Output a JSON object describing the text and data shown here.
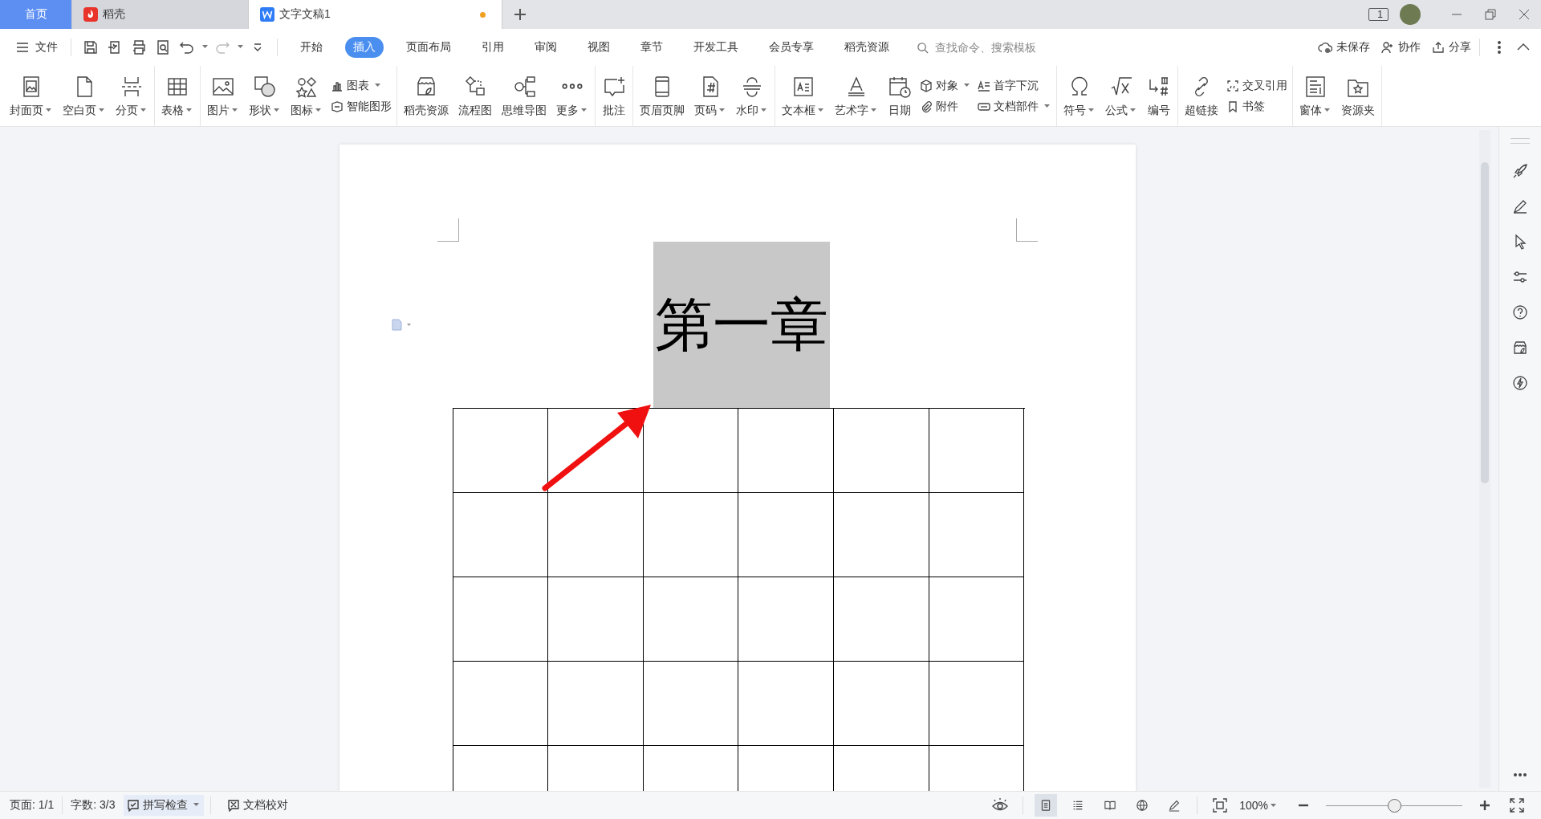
{
  "tabs": [
    {
      "label": "首页",
      "kind": "home",
      "selected": false,
      "modified": false
    },
    {
      "label": "稻壳",
      "kind": "docer",
      "selected": false,
      "modified": false
    },
    {
      "label": "文字文稿1",
      "kind": "doc",
      "selected": true,
      "modified": true
    }
  ],
  "window_count": "1",
  "menu": {
    "file": "文件",
    "redo_disabled": true,
    "tabs": [
      {
        "label": "开始",
        "selected": false
      },
      {
        "label": "插入",
        "selected": true
      },
      {
        "label": "页面布局",
        "selected": false
      },
      {
        "label": "引用",
        "selected": false
      },
      {
        "label": "审阅",
        "selected": false
      },
      {
        "label": "视图",
        "selected": false
      },
      {
        "label": "章节",
        "selected": false
      },
      {
        "label": "开发工具",
        "selected": false
      },
      {
        "label": "会员专享",
        "selected": false
      },
      {
        "label": "稻壳资源",
        "selected": false
      }
    ],
    "search": {
      "placeholder": "查找命令、搜索模板"
    },
    "actions": [
      "未保存",
      "协作",
      "分享"
    ]
  },
  "ribbon": [
    [
      {
        "kind": "large",
        "label": "封面页",
        "caret": true
      },
      {
        "kind": "large",
        "label": "空白页",
        "caret": true
      },
      {
        "kind": "large",
        "label": "分页",
        "caret": true
      }
    ],
    [
      {
        "kind": "large",
        "label": "表格",
        "caret": true
      }
    ],
    [
      {
        "kind": "large",
        "label": "图片",
        "caret": true
      },
      {
        "kind": "large",
        "label": "形状",
        "caret": true
      },
      {
        "kind": "large",
        "label": "图标",
        "caret": true
      },
      {
        "kind": "stack",
        "items": [
          {
            "label": "图表",
            "caret": true
          },
          {
            "label": "智能图形",
            "caret": false
          }
        ]
      }
    ],
    [
      {
        "kind": "large",
        "label": "稻壳资源",
        "caret": false
      },
      {
        "kind": "large",
        "label": "流程图",
        "caret": false
      },
      {
        "kind": "large",
        "label": "思维导图",
        "caret": false
      },
      {
        "kind": "large",
        "label": "更多",
        "caret": true
      }
    ],
    [
      {
        "kind": "large",
        "label": "批注",
        "caret": false
      }
    ],
    [
      {
        "kind": "large",
        "label": "页眉页脚",
        "caret": false
      },
      {
        "kind": "large",
        "label": "页码",
        "caret": true
      },
      {
        "kind": "large",
        "label": "水印",
        "caret": true
      }
    ],
    [
      {
        "kind": "large",
        "label": "文本框",
        "caret": true
      },
      {
        "kind": "large",
        "label": "艺术字",
        "caret": true
      },
      {
        "kind": "large",
        "label": "日期",
        "caret": false
      },
      {
        "kind": "stack",
        "items": [
          {
            "label": "对象",
            "caret": true
          },
          {
            "label": "附件",
            "caret": false
          }
        ]
      },
      {
        "kind": "stack",
        "items": [
          {
            "label": "首字下沉",
            "caret": false
          },
          {
            "label": "文档部件",
            "caret": true
          }
        ]
      }
    ],
    [
      {
        "kind": "large",
        "label": "符号",
        "caret": true
      },
      {
        "kind": "large",
        "label": "公式",
        "caret": true
      },
      {
        "kind": "large",
        "label": "编号",
        "caret": false
      }
    ],
    [
      {
        "kind": "large",
        "label": "超链接",
        "caret": false
      },
      {
        "kind": "stack",
        "items": [
          {
            "label": "交叉引用",
            "caret": false
          },
          {
            "label": "书签",
            "caret": false
          }
        ]
      }
    ],
    [
      {
        "kind": "large",
        "label": "窗体",
        "caret": true
      },
      {
        "kind": "large",
        "label": "资源夹",
        "caret": false
      }
    ]
  ],
  "document": {
    "heading": "第一章",
    "heading_shaded": true
  },
  "status_bar": {
    "page": "页面: 1/1",
    "words": "字数: 3/3",
    "spell_check": {
      "label": "拼写检查",
      "on": true
    },
    "proofread": "文档校对",
    "view_modes": [
      {
        "selected": true
      },
      {
        "selected": false
      },
      {
        "selected": false
      },
      {
        "selected": false
      },
      {
        "selected": false
      }
    ],
    "zoom": "100%",
    "zoom_level": {
      "level": 0.5
    }
  }
}
